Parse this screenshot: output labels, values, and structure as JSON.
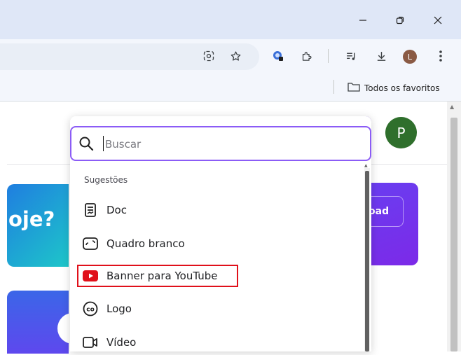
{
  "window": {
    "controls": [
      "minimize-icon",
      "restore-icon",
      "close-icon"
    ]
  },
  "toolbar": {
    "icons": [
      "lens-icon",
      "star-icon",
      "extension-badge-icon",
      "puzzle-icon",
      "media-icon",
      "download-icon",
      "menu-icon"
    ],
    "profile_initial": "L"
  },
  "bookmarks": {
    "all_bookmarks_label": "Todos os favoritos"
  },
  "page": {
    "banner_text": "oje?",
    "upload_label": "oad",
    "avatar_initial": "P"
  },
  "search": {
    "placeholder": "Buscar",
    "value": ""
  },
  "suggestions": {
    "heading": "Sugestões",
    "items": [
      {
        "label": "Doc",
        "icon": "doc-icon"
      },
      {
        "label": "Quadro branco",
        "icon": "whiteboard-icon"
      },
      {
        "label": "Banner para YouTube",
        "icon": "youtube-icon"
      },
      {
        "label": "Logo",
        "icon": "logo-icon"
      },
      {
        "label": "Vídeo",
        "icon": "video-icon"
      }
    ]
  },
  "colors": {
    "accent": "#8b5cf6",
    "highlight_border": "#e0101a",
    "youtube_red": "#e0101a",
    "avatar_p": "#2f6f2c",
    "avatar_l": "#8a5a44"
  }
}
